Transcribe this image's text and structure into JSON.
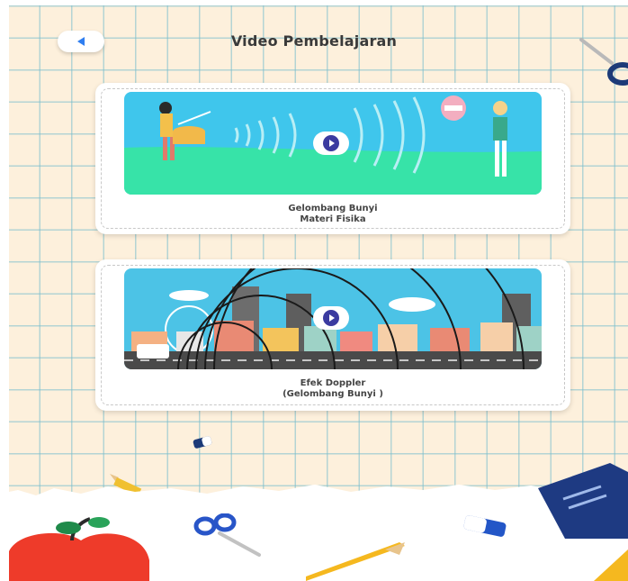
{
  "header": {
    "title": "Video Pembelajaran",
    "back_icon": "back-arrow-icon"
  },
  "videos": [
    {
      "title_line1": "Gelombang Bunyi",
      "title_line2": "Materi Fisika",
      "thumbnail": "drummer-sound-waves-illustration"
    },
    {
      "title_line1": "Efek Doppler",
      "title_line2": "(Gelombang Bunyi )",
      "thumbnail": "city-ambulance-doppler-illustration"
    }
  ],
  "colors": {
    "accent": "#3b3ba0",
    "back_arrow": "#2f7ef0",
    "grid": "#78bece",
    "background": "#fdf0dc"
  }
}
